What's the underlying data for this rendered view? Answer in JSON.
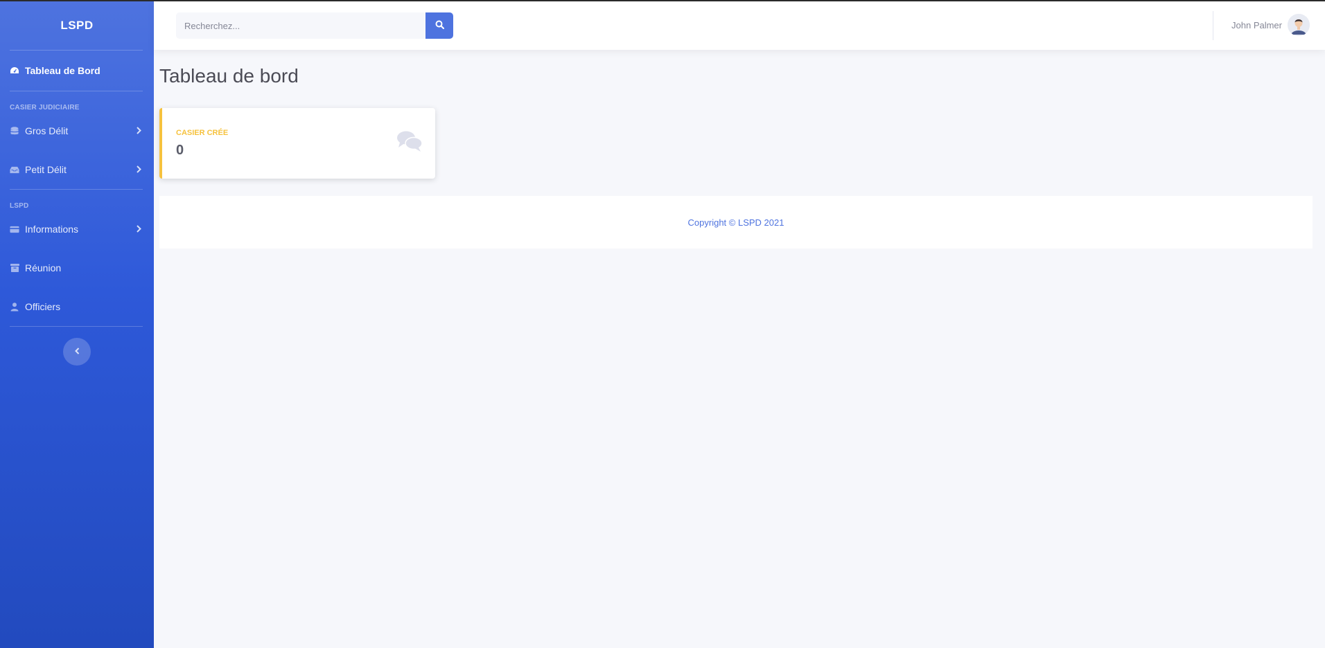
{
  "sidebar": {
    "brand": "LSPD",
    "active_item": {
      "label": "Tableau de Bord",
      "icon": "dashboard-icon"
    },
    "sections": [
      {
        "heading": "CASIER JUDICIAIRE",
        "items": [
          {
            "label": "Gros Délit",
            "icon": "database-icon",
            "has_submenu": true
          },
          {
            "label": "Petit Délit",
            "icon": "inbox-icon",
            "has_submenu": true
          }
        ]
      },
      {
        "heading": "LSPD",
        "items": [
          {
            "label": "Informations",
            "icon": "card-icon",
            "has_submenu": true
          },
          {
            "label": "Réunion",
            "icon": "archive-icon",
            "has_submenu": false
          },
          {
            "label": "Officiers",
            "icon": "user-icon",
            "has_submenu": false
          }
        ]
      }
    ],
    "toggle_icon": "chevron-left-icon"
  },
  "topbar": {
    "search_placeholder": "Recherchez...",
    "search_icon": "search-icon",
    "user_name": "John Palmer",
    "avatar_icon": "avatar-icon"
  },
  "main": {
    "page_title": "Tableau de bord",
    "cards": [
      {
        "label": "CASIER CRÉE",
        "value": "0",
        "icon": "comments-icon",
        "accent_color": "#f6c23e"
      }
    ]
  },
  "footer": {
    "text": "Copyright © LSPD 2021"
  },
  "colors": {
    "primary": "#4e73df",
    "sidebar_gradient_end": "#224abe",
    "warning": "#f6c23e",
    "background": "#f6f7fb"
  }
}
